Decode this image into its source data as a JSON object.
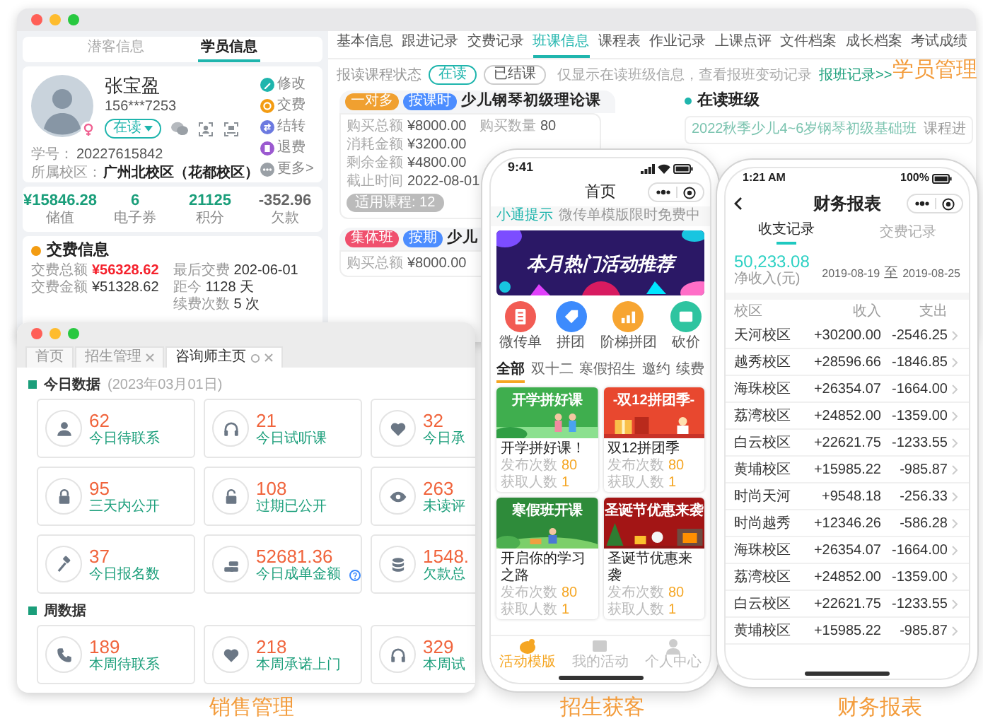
{
  "student_window": {
    "side_tabs": [
      {
        "label": "潜客信息",
        "selected": false
      },
      {
        "label": "学员信息",
        "selected": true
      }
    ],
    "student": {
      "name": "张宝盈",
      "phone": "156***7253",
      "status": "在读",
      "id_label": "学号：",
      "id": "20227615842",
      "campus_label": "所属校区：",
      "campus": "广州北校区（花都校区）"
    },
    "actions": [
      {
        "label": "修改",
        "color": "#1fb5ad"
      },
      {
        "label": "交费",
        "color": "#f39c12"
      },
      {
        "label": "结转",
        "color": "#6c7ae0"
      },
      {
        "label": "退费",
        "color": "#9b59d0"
      },
      {
        "label": "更多>",
        "color": "#9aa0a6"
      }
    ],
    "stats": [
      {
        "value": "¥15846.28",
        "label": "储值",
        "color": "#1a9e7a"
      },
      {
        "value": "6",
        "label": "电子券",
        "color": "#1a9e7a"
      },
      {
        "value": "21125",
        "label": "积分",
        "color": "#1a9e7a"
      },
      {
        "value": "-352.96",
        "label": "欠款",
        "color": "#666666"
      }
    ],
    "pay_info": {
      "title": "交费信息",
      "fields": [
        {
          "label": "交费总额",
          "value": "¥56328.62",
          "highlighted": true
        },
        {
          "label": "最后交费",
          "value": "202-06-01",
          "highlighted": false
        },
        {
          "label": "交费金额",
          "value": "¥51328.62",
          "highlighted": false
        },
        {
          "label": "距今",
          "value": "1128 天",
          "highlighted": false
        },
        {
          "label": "续费次数",
          "value": "5 次",
          "highlighted": false
        }
      ]
    },
    "tabs": [
      {
        "label": "基本信息",
        "selected": false
      },
      {
        "label": "跟进记录",
        "selected": false
      },
      {
        "label": "交费记录",
        "selected": false
      },
      {
        "label": "班课信息",
        "selected": true
      },
      {
        "label": "课程表",
        "selected": false
      },
      {
        "label": "作业记录",
        "selected": false
      },
      {
        "label": "上课点评",
        "selected": false
      },
      {
        "label": "文件档案",
        "selected": false
      },
      {
        "label": "成长档案",
        "selected": false
      },
      {
        "label": "考试成绩",
        "selected": false
      }
    ],
    "filter": {
      "label": "报读课程状态",
      "options": [
        {
          "label": "在读",
          "selected": true
        },
        {
          "label": "已结课",
          "selected": false
        }
      ],
      "hint": "仅显示在读班级信息，查看报班变动记录",
      "link": "报班记录>>"
    },
    "classes": [
      {
        "badges": [
          {
            "label": "一对多",
            "color": "#f0a030"
          },
          {
            "label": "按课时",
            "color": "#4c8dff"
          }
        ],
        "title": "少儿钢琴初级理论课",
        "fields": [
          {
            "label": "购买总额",
            "value": "¥8000.00"
          },
          {
            "label": "购买数量",
            "value": "80"
          },
          {
            "label": "消耗金额",
            "value": "¥3200.00"
          },
          {
            "label": "剩余金额",
            "value": "¥4800.00"
          },
          {
            "label": "截止时间",
            "value": "2022-08-01"
          }
        ],
        "courses": "适用课程: 12"
      },
      {
        "badges": [
          {
            "label": "集体班",
            "color": "#f0506e"
          },
          {
            "label": "按期",
            "color": "#4c8dff"
          }
        ],
        "title": "少儿",
        "fields": [
          {
            "label": "购买总额",
            "value": "¥8000.00"
          }
        ]
      }
    ],
    "current_classes": {
      "title": "在读班级",
      "rows": [
        {
          "name": "2022秋季少儿4~6岁钢琴初级基础班",
          "progress": "课程进"
        }
      ]
    }
  },
  "sales_window": {
    "tabs": [
      {
        "label": "首页",
        "selected": false,
        "closable": false
      },
      {
        "label": "招生管理",
        "selected": false,
        "closable": true
      },
      {
        "label": "咨询师主页",
        "selected": true,
        "closable": true
      }
    ],
    "sections": [
      {
        "title": "今日数据",
        "date": "(2023年03月01日)",
        "cards": [
          {
            "value": "62",
            "label": "今日待联系",
            "help": false
          },
          {
            "value": "21",
            "label": "今日试听课",
            "help": false
          },
          {
            "value": "32",
            "label": "今日承",
            "help": false
          },
          {
            "value": "95",
            "label": "三天内公开",
            "help": false
          },
          {
            "value": "108",
            "label": "过期已公开",
            "help": false
          },
          {
            "value": "263",
            "label": "未读评",
            "help": false
          },
          {
            "value": "37",
            "label": "今日报名数",
            "help": false
          },
          {
            "value": "52681.36",
            "label": "今日成单金额",
            "help": true
          },
          {
            "value": "1548.",
            "label": "欠款总",
            "help": false
          }
        ]
      },
      {
        "title": "周数据",
        "cards": [
          {
            "value": "189",
            "label": "本周待联系",
            "help": false
          },
          {
            "value": "218",
            "label": "本周承诺上门",
            "help": false
          },
          {
            "value": "329",
            "label": "本周试",
            "help": false
          }
        ]
      }
    ]
  },
  "marketing_phone": {
    "time": "9:41",
    "title": "首页",
    "notice_tag": "小通提示",
    "notice": "微传单模版限时免费中",
    "banner": "本月热门活动推荐",
    "features": [
      {
        "label": "微传单",
        "color": "#f25c54"
      },
      {
        "label": "拼团",
        "color": "#3d8bfd"
      },
      {
        "label": "阶梯拼团",
        "color": "#f7a531"
      },
      {
        "label": "砍价",
        "color": "#2ec4a0"
      }
    ],
    "categories": [
      {
        "label": "全部",
        "selected": true
      },
      {
        "label": "双十二",
        "selected": false
      },
      {
        "label": "寒假招生",
        "selected": false
      },
      {
        "label": "邀约",
        "selected": false
      },
      {
        "label": "续费",
        "selected": false
      }
    ],
    "activities": [
      {
        "poster": "开学拼好课",
        "title": "开学拼好课！",
        "stats": [
          {
            "label": "发布次数",
            "value": "80"
          },
          {
            "label": "获取人数",
            "value": "1"
          }
        ]
      },
      {
        "poster": "-双12拼团季-",
        "title": "双12拼团季",
        "stats": [
          {
            "label": "发布次数",
            "value": "80"
          },
          {
            "label": "获取人数",
            "value": "1"
          }
        ]
      },
      {
        "poster": "寒假班开课",
        "title": "开启你的学习之路",
        "stats": [
          {
            "label": "发布次数",
            "value": "80"
          },
          {
            "label": "获取人数",
            "value": "1"
          }
        ]
      },
      {
        "poster": "圣诞节优惠来袭",
        "title": "圣诞节优惠来袭",
        "stats": [
          {
            "label": "发布次数",
            "value": "80"
          },
          {
            "label": "获取人数",
            "value": "1"
          }
        ]
      }
    ],
    "tabbar": [
      {
        "label": "活动模版",
        "selected": true
      },
      {
        "label": "我的活动",
        "selected": false
      },
      {
        "label": "个人中心",
        "selected": false
      }
    ]
  },
  "finance_phone": {
    "time": "1:21 AM",
    "battery": "100%",
    "title": "财务报表",
    "tabs": [
      {
        "label": "收支记录",
        "selected": true
      },
      {
        "label": "交费记录",
        "selected": false
      }
    ],
    "net_income": "50,233.08",
    "net_income_label": "净收入(元)",
    "date_from": "2019-08-19",
    "date_sep": "至",
    "date_to": "2019-08-25",
    "columns": [
      "校区",
      "收入",
      "支出"
    ],
    "rows": [
      {
        "campus": "天河校区",
        "income": "+30200.00",
        "expense": "-2546.25"
      },
      {
        "campus": "越秀校区",
        "income": "+28596.66",
        "expense": "-1846.85"
      },
      {
        "campus": "海珠校区",
        "income": "+26354.07",
        "expense": "-1664.00"
      },
      {
        "campus": "荔湾校区",
        "income": "+24852.00",
        "expense": "-1359.00"
      },
      {
        "campus": "白云校区",
        "income": "+22621.75",
        "expense": "-1233.55"
      },
      {
        "campus": "黄埔校区",
        "income": "+15985.22",
        "expense": "-985.87"
      },
      {
        "campus": "时尚天河",
        "income": "+9548.18",
        "expense": "-256.33"
      },
      {
        "campus": "时尚越秀",
        "income": "+12346.26",
        "expense": "-586.28"
      },
      {
        "campus": "海珠校区",
        "income": "+26354.07",
        "expense": "-1664.00"
      },
      {
        "campus": "荔湾校区",
        "income": "+24852.00",
        "expense": "-1359.00"
      },
      {
        "campus": "白云校区",
        "income": "+22621.75",
        "expense": "-1233.55"
      },
      {
        "campus": "黄埔校区",
        "income": "+15985.22",
        "expense": "-985.87"
      }
    ]
  },
  "captions": [
    {
      "text": "学员管理"
    },
    {
      "text": "销售管理"
    },
    {
      "text": "招生获客"
    },
    {
      "text": "财务报表"
    }
  ]
}
